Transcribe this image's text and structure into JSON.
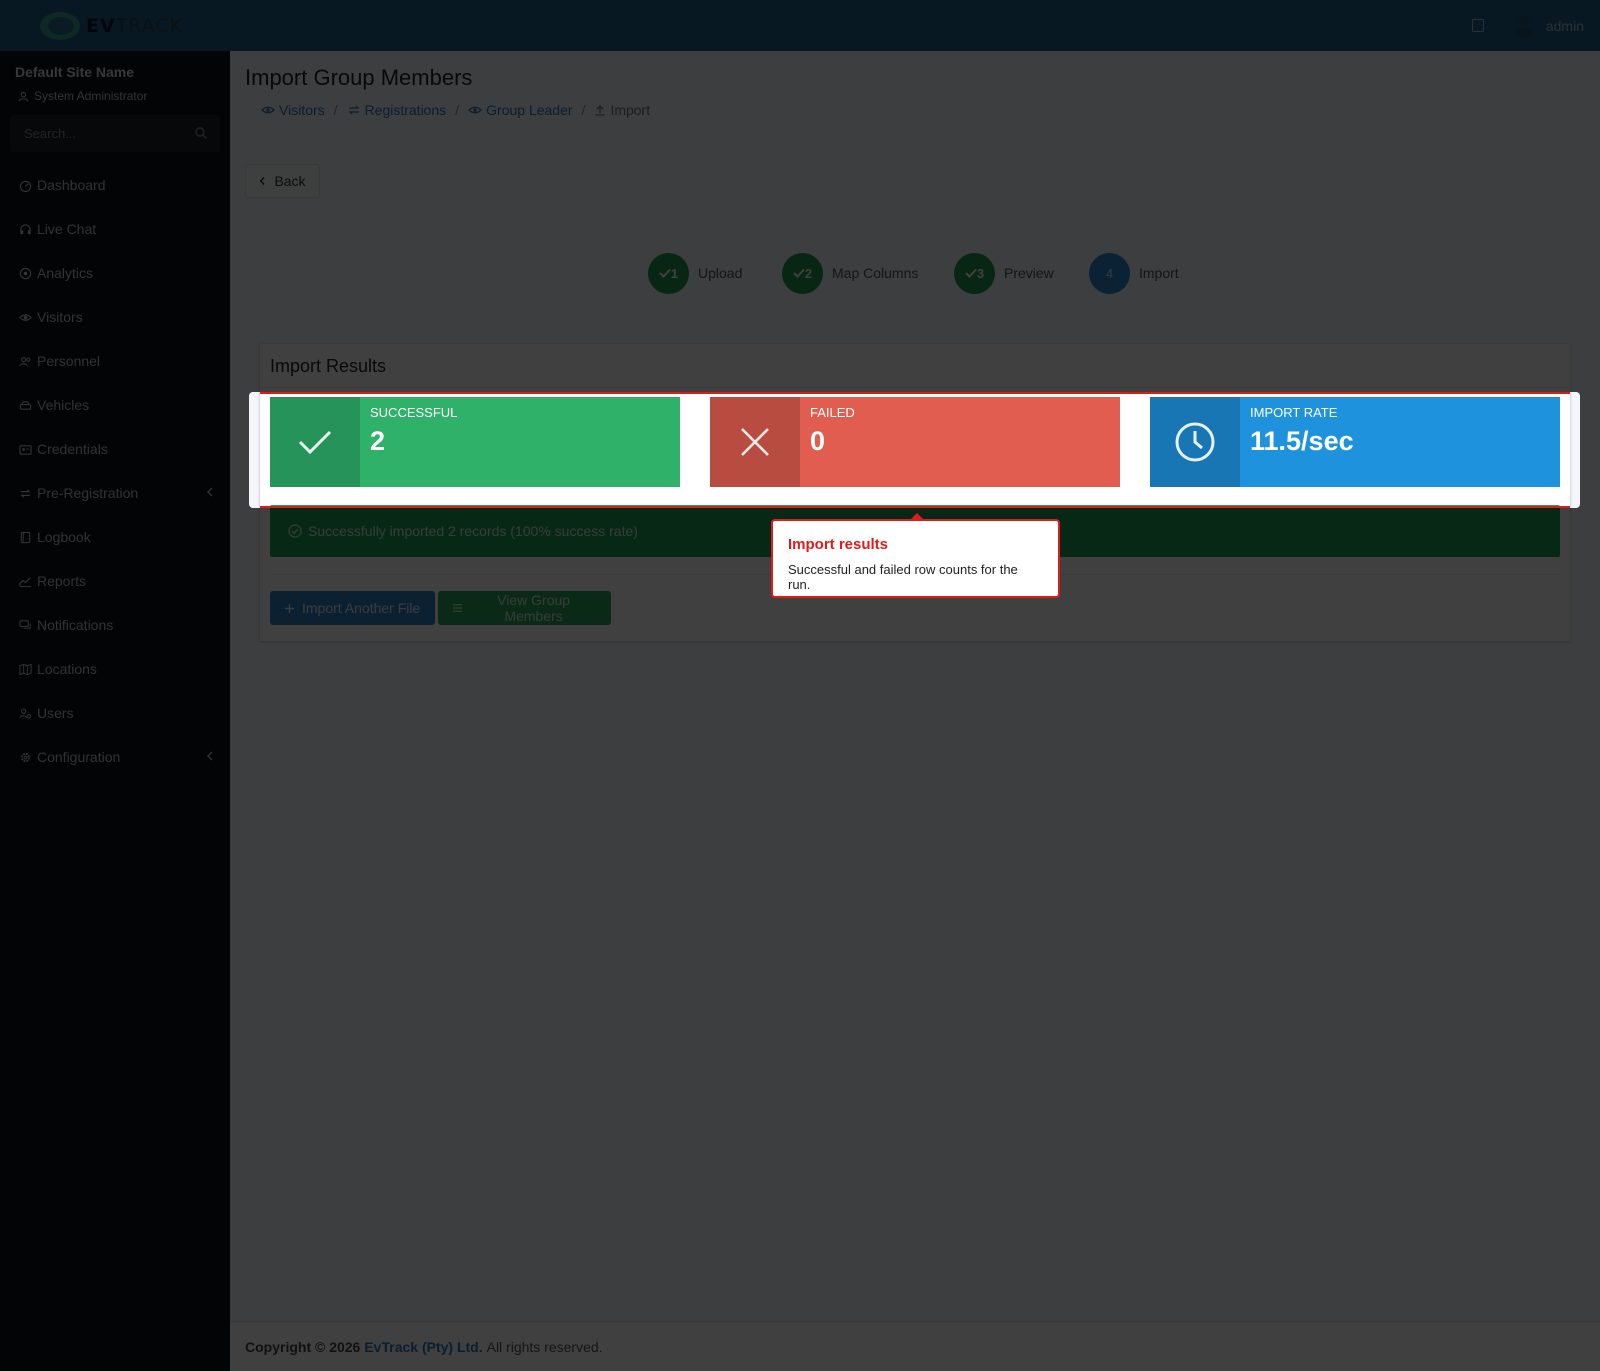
{
  "brand": {
    "name_bold": "EV",
    "name_rest": "TRACK"
  },
  "header": {
    "user_name": "admin"
  },
  "sidebar": {
    "site_name": "Default Site Name",
    "role": "System Administrator",
    "search_placeholder": "Search...",
    "items": [
      {
        "label": "Dashboard",
        "icon": "dashboard-icon"
      },
      {
        "label": "Live Chat",
        "icon": "headset-icon"
      },
      {
        "label": "Analytics",
        "icon": "analytics-icon"
      },
      {
        "label": "Visitors",
        "icon": "eye-icon"
      },
      {
        "label": "Personnel",
        "icon": "users-icon"
      },
      {
        "label": "Vehicles",
        "icon": "car-icon"
      },
      {
        "label": "Credentials",
        "icon": "id-card-icon"
      },
      {
        "label": "Pre-Registration",
        "icon": "exchange-icon",
        "expandable": true
      },
      {
        "label": "Logbook",
        "icon": "book-icon"
      },
      {
        "label": "Reports",
        "icon": "chart-icon"
      },
      {
        "label": "Notifications",
        "icon": "comments-icon"
      },
      {
        "label": "Locations",
        "icon": "map-icon"
      },
      {
        "label": "Users",
        "icon": "user-cog-icon"
      },
      {
        "label": "Configuration",
        "icon": "cog-icon",
        "expandable": true
      }
    ]
  },
  "page": {
    "title": "Import Group Members",
    "breadcrumb": [
      "Visitors",
      "Registrations",
      "Group Leader",
      "Import"
    ],
    "back_label": "Back"
  },
  "stepper": {
    "steps": [
      {
        "number": "1",
        "label": "Upload",
        "state": "done"
      },
      {
        "number": "2",
        "label": "Map Columns",
        "state": "done"
      },
      {
        "number": "3",
        "label": "Preview",
        "state": "done"
      },
      {
        "number": "4",
        "label": "Import",
        "state": "current"
      }
    ]
  },
  "results": {
    "title": "Import Results",
    "successful": {
      "label": "Successful",
      "value": "2",
      "color": "#2fb169"
    },
    "failed": {
      "label": "Failed",
      "value": "0",
      "color": "#e05d4f"
    },
    "rate": {
      "label": "Import Rate",
      "value": "11.5/sec",
      "color": "#1f92de"
    },
    "alert": "Successfully imported 2 records (100% success rate)",
    "import_another_label": "Import Another File",
    "view_members_label": "View Group Members"
  },
  "footer": {
    "copyright": "Copyright © 2026",
    "company": "EvTrack (Pty) Ltd.",
    "rights": "All rights reserved."
  },
  "tooltip": {
    "title": "Import results",
    "text": "Successful and failed row counts for the run."
  }
}
